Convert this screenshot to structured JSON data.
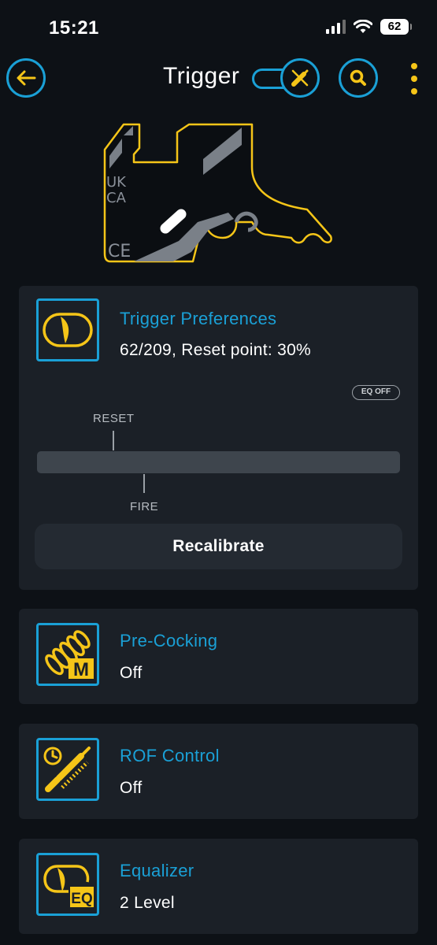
{
  "status_bar": {
    "time": "15:21",
    "battery": "62"
  },
  "header": {
    "title": "Trigger"
  },
  "hero": {
    "marks": [
      "UK",
      "CA",
      "CE"
    ]
  },
  "trigger_preferences": {
    "title": "Trigger Preferences",
    "value": "62/209, Reset point: 30%",
    "eq_badge": "EQ OFF",
    "reset_label": "RESET",
    "fire_label": "FIRE",
    "recalibrate_label": "Recalibrate"
  },
  "pre_cocking": {
    "title": "Pre-Cocking",
    "value": "Off",
    "icon_letter": "M"
  },
  "rof_control": {
    "title": "ROF Control",
    "value": "Off"
  },
  "equalizer": {
    "title": "Equalizer",
    "value": "2 Level",
    "icon_letters": "EQ"
  },
  "colors": {
    "accent_blue": "#1aa0d6",
    "accent_yellow": "#f5c518",
    "background": "#0d1116",
    "card": "#1b2027"
  }
}
